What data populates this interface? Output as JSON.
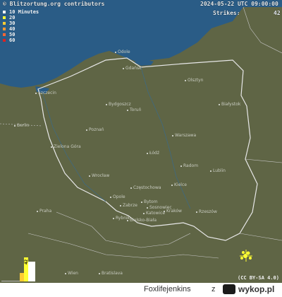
{
  "map": {
    "source": "© Blitzortung.org contributors",
    "timestamp": "2024-05-22 UTC 09:00:00",
    "strikes_label": "Strikes:",
    "strikes_value": "42",
    "license": "(CC BY-SA 4.0)",
    "colors": {
      "land": "#5f6545",
      "sea": "#2a5c86",
      "border": "#e8e8e8"
    },
    "legend": [
      {
        "label": "10 Minutes",
        "color": "#ffffff"
      },
      {
        "label": "20",
        "color": "#ffff33"
      },
      {
        "label": "30",
        "color": "#ffcc33"
      },
      {
        "label": "40",
        "color": "#ff9933"
      },
      {
        "label": "50",
        "color": "#ff6633"
      },
      {
        "label": "60",
        "color": "#dd2222"
      }
    ],
    "cities": [
      "Odole",
      "Gdańsk",
      "Olsztyn",
      "Szczecin",
      "Bydgoszcz",
      "Toruń",
      "Białystok",
      "Berlin",
      "Poznań",
      "Warszawa",
      "Zielona Góra",
      "Łódź",
      "Radom",
      "Lublin",
      "Wrocław",
      "Częstochowa",
      "Kielce",
      "Opole",
      "Bytom",
      "Sosnowiec",
      "Praha",
      "Zabrze",
      "Katowice",
      "Kraków",
      "Rzeszów",
      "Rybnik",
      "Bielsko-Biała",
      "Wien",
      "Bratislava"
    ],
    "histogram_count": "42"
  },
  "footer": {
    "username": "Foxlifejenkins",
    "z": "z",
    "site": "wykop.pl"
  }
}
